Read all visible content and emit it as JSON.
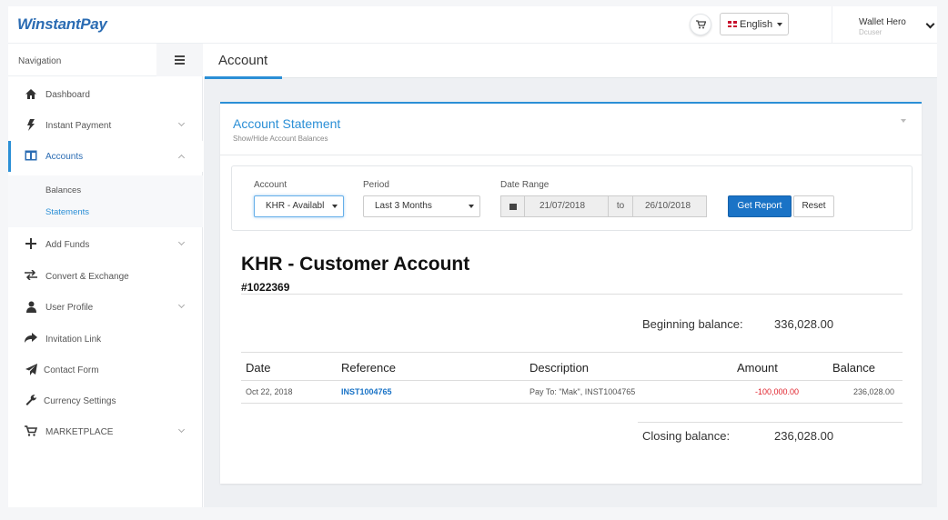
{
  "app": {
    "logo": "WinstantPay"
  },
  "header": {
    "language": "English",
    "user": {
      "name": "Wallet Hero",
      "role": "Dcuser"
    }
  },
  "sidebar": {
    "title": "Navigation",
    "items": [
      {
        "label": "Dashboard",
        "icon": "home-icon"
      },
      {
        "label": "Instant Payment",
        "icon": "bolt-icon"
      },
      {
        "label": "Accounts",
        "icon": "columns-icon"
      },
      {
        "label": "Add Funds",
        "icon": "plus-icon"
      },
      {
        "label": "Convert & Exchange",
        "icon": "exchange-icon"
      },
      {
        "label": "User Profile",
        "icon": "user-icon"
      },
      {
        "label": "Invitation Link",
        "icon": "share-icon"
      },
      {
        "label": "Contact Form",
        "icon": "paper-plane-icon"
      },
      {
        "label": "Currency Settings",
        "icon": "wrench-icon"
      },
      {
        "label": "MARKETPLACE",
        "icon": "cart-icon"
      }
    ],
    "subitems": [
      {
        "label": "Balances"
      },
      {
        "label": "Statements"
      }
    ]
  },
  "page": {
    "title": "Account"
  },
  "statement": {
    "title": "Account Statement",
    "subtitle": "Show/Hide Account Balances",
    "filters": {
      "account_label": "Account",
      "account_value": "KHR - Availabl",
      "period_label": "Period",
      "period_value": "Last 3 Months",
      "range_label": "Date Range",
      "date_from": "21/07/2018",
      "to_label": "to",
      "date_to": "26/10/2018",
      "get_report": "Get Report",
      "reset": "Reset"
    },
    "account_name": "KHR - Customer Account",
    "account_number": "#1022369",
    "beginning_label": "Beginning balance:",
    "beginning_value": "336,028.00",
    "columns": [
      "Date",
      "Reference",
      "Description",
      "Amount",
      "Balance"
    ],
    "rows": [
      {
        "date": "Oct 22, 2018",
        "reference": "INST1004765",
        "description": "Pay To: \"Mak\", INST1004765",
        "amount": "-100,000.00",
        "balance": "236,028.00"
      }
    ],
    "closing_label": "Closing balance:",
    "closing_value": "236,028.00"
  },
  "colors": {
    "accent": "#2b8fd6",
    "primary_button": "#1a73c6",
    "negative": "#e0202a"
  }
}
